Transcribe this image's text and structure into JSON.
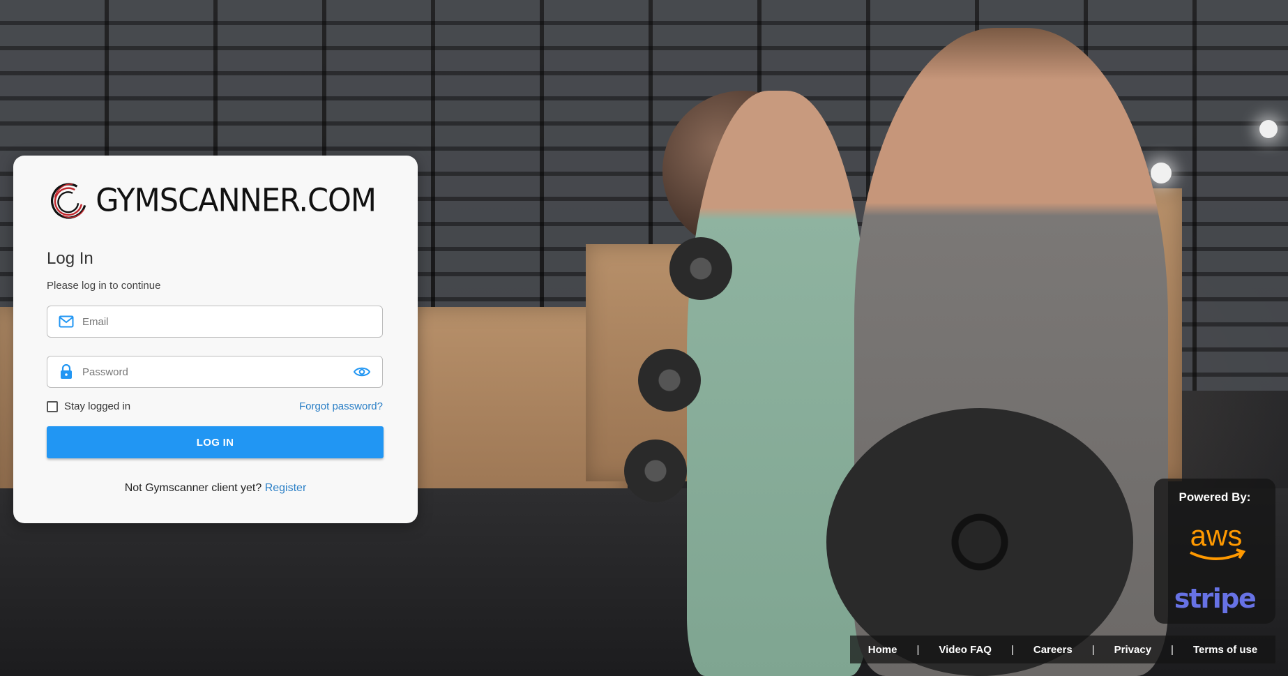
{
  "brand": {
    "logo_text": "GYMSCANNER.COM"
  },
  "login": {
    "title": "Log In",
    "subtitle": "Please log in to continue",
    "email_placeholder": "Email",
    "password_placeholder": "Password",
    "stay_logged_in_label": "Stay logged in",
    "stay_logged_in_checked": false,
    "forgot_password": "Forgot password?",
    "login_button": "LOG IN",
    "not_client_text": "Not Gymscanner client yet?",
    "register_link": "Register"
  },
  "powered_by": {
    "label": "Powered By:",
    "providers": [
      "aws",
      "stripe"
    ]
  },
  "footer": {
    "links": [
      "Home",
      "Video FAQ",
      "Careers",
      "Privacy",
      "Terms of use"
    ],
    "separator": "|"
  },
  "colors": {
    "accent": "#2196f3",
    "link": "#2a7fc6",
    "logo_red": "#c0272d",
    "stripe": "#6772e5",
    "aws_orange": "#ff9900"
  },
  "icons": {
    "email": "mail-icon",
    "password": "lock-icon",
    "toggle": "eye-icon"
  }
}
